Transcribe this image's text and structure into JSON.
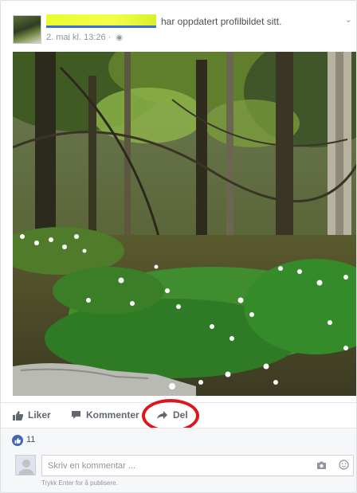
{
  "post": {
    "action_text": "har oppdatert profilbildet sitt.",
    "timestamp": "2. mai kl. 13:26 · ",
    "privacy_icon": "globe-icon",
    "menu_icon": "chevron-down-icon"
  },
  "actions": {
    "like_label": "Liker",
    "comment_label": "Kommenter",
    "share_label": "Del",
    "highlight_color": "#e0141b"
  },
  "reactions": {
    "like_count": "11",
    "accent": "#4267b2"
  },
  "composer": {
    "placeholder": "Skriv en kommentar ...",
    "hint": "Trykk Enter for å publisere."
  }
}
